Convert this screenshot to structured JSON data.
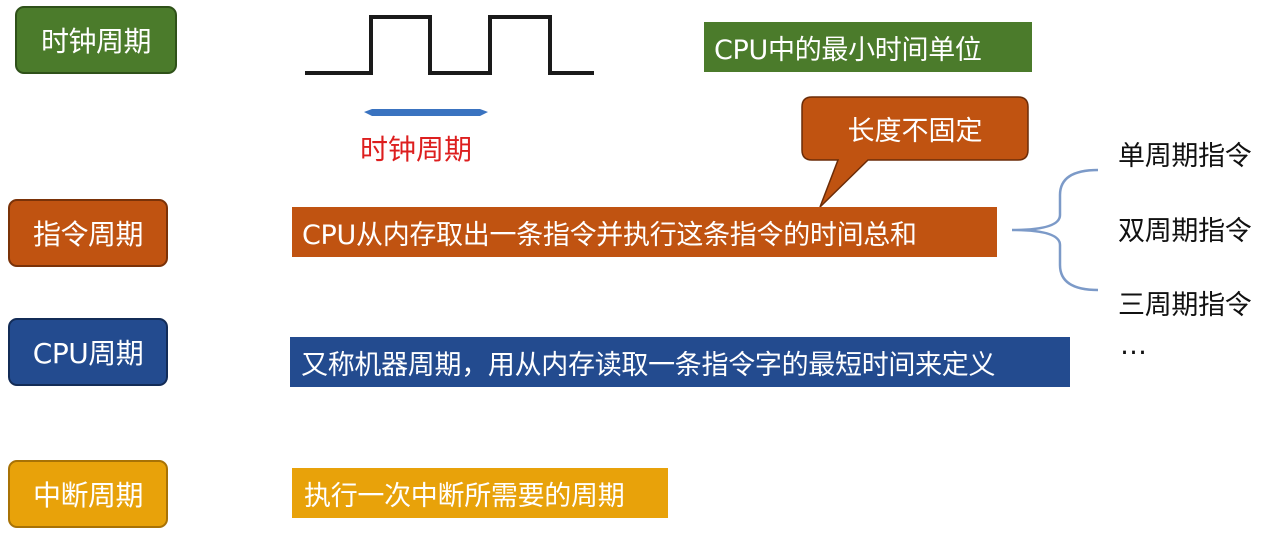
{
  "colors": {
    "green": "#4b7b2b",
    "orange": "#c05311",
    "blue": "#234b8f",
    "gold": "#e8a20a",
    "red_text": "#dd1f1f",
    "ribbon_blue": "#3a73c0"
  },
  "rows": {
    "clock": {
      "label": "时钟周期",
      "desc": "CPU中的最小时间单位",
      "waveform_label": "时钟周期"
    },
    "instruction": {
      "label": "指令周期",
      "desc": "CPU从内存取出一条指令并执行这条指令的时间总和",
      "callout": "长度不固定"
    },
    "cpu": {
      "label": "CPU周期",
      "desc": "又称机器周期，用从内存读取一条指令字的最短时间来定义"
    },
    "interrupt": {
      "label": "中断周期",
      "desc": "执行一次中断所需要的周期"
    }
  },
  "instruction_types": [
    "单周期指令",
    "双周期指令",
    "三周期指令",
    "…"
  ]
}
